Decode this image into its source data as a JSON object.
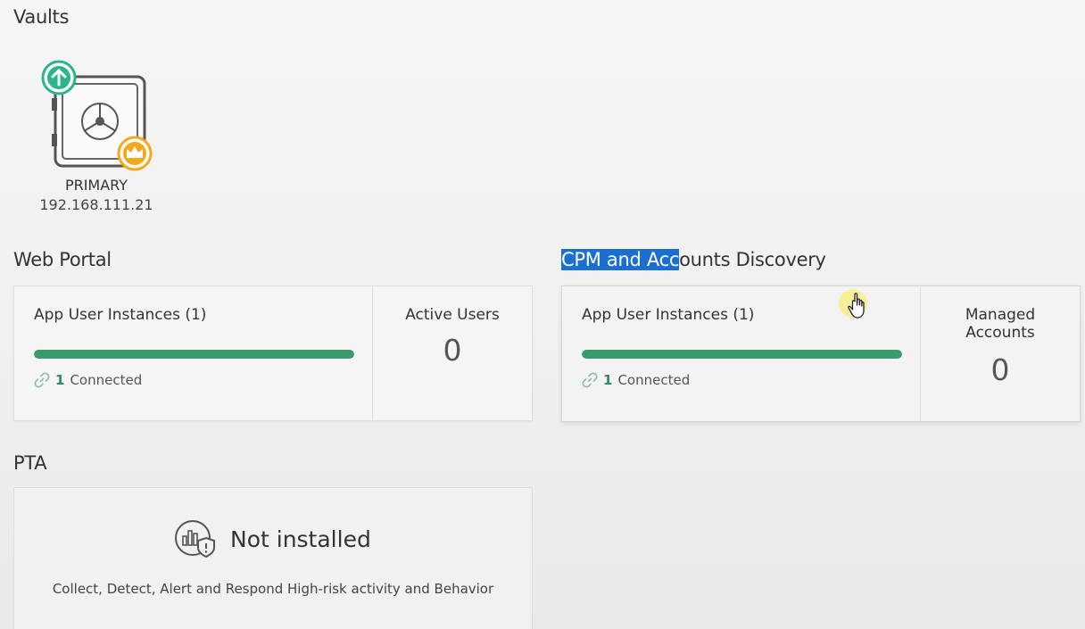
{
  "vaults": {
    "title": "Vaults",
    "items": [
      {
        "name": "PRIMARY",
        "ip": "192.168.111.21",
        "status_icon": "arrow-up-icon",
        "badge_icon": "crown-icon"
      }
    ]
  },
  "web_portal": {
    "title": "Web Portal",
    "instances_label": "App User Instances (1)",
    "progress": 1.0,
    "connected_count": "1",
    "connected_label": "Connected",
    "right_label": "Active Users",
    "right_value": "0"
  },
  "cpm": {
    "title_highlighted": "CPM and Acc",
    "title_rest": "ounts Discovery",
    "instances_label": "App User Instances (1)",
    "progress": 1.0,
    "connected_count": "1",
    "connected_label": "Connected",
    "right_label_line1": "Managed",
    "right_label_line2": "Accounts",
    "right_value": "0"
  },
  "pta": {
    "title": "PTA",
    "status": "Not installed",
    "description": "Collect, Detect, Alert and Respond High-risk activity and Behavior",
    "icon": "analytics-shield-icon"
  },
  "colors": {
    "accent_green": "#3a9a6c",
    "badge_orange": "#f4a81e",
    "status_teal": "#2bb58a",
    "selection_blue": "#1a6fd0"
  }
}
